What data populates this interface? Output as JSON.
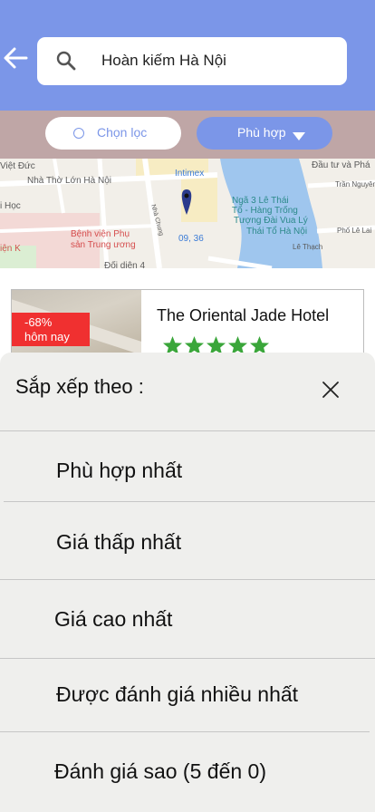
{
  "header": {
    "search_value": "Hoàn kiếm Hà Nội",
    "bg_color": "#7b96e8"
  },
  "filters": {
    "filter_label": "Chọn lọc",
    "sort_label": "Phù hợp"
  },
  "map": {
    "labels": [
      "Việt Đức",
      "Nhà Thờ Lớn Hà Nội",
      "Intimex",
      "Đầu tư và Phá",
      "Trần Nguyên",
      "i Học",
      "Ngã 3 Lê Thái",
      "Tổ - Hàng Trống",
      "Tượng Đài Vua Lý",
      "Thái Tổ Hà Nội",
      "Phố Lê Lai",
      "Bệnh viện Phụ",
      "sản Trung ương",
      "iện K",
      "09, 36",
      "Lê Thạch",
      "Đối diện 4",
      "Nhà Chung"
    ]
  },
  "hotel": {
    "name": "The Oriental Jade Hotel",
    "discount_percent": "-68%",
    "discount_period": "hôm nay",
    "stars": 5
  },
  "sort_sheet": {
    "title": "Sắp xếp theo :",
    "options": [
      "Phù hợp nhất",
      "Giá thấp nhất",
      "Giá cao nhất",
      "Được đánh giá nhiều nhất",
      "Đánh giá sao (5 đến 0)"
    ]
  },
  "colors": {
    "accent": "#7b96e8",
    "filter_bar": "#bfa6a6",
    "discount": "#f03030",
    "star": "#3aa63a",
    "sheet_bg": "#efefed"
  }
}
